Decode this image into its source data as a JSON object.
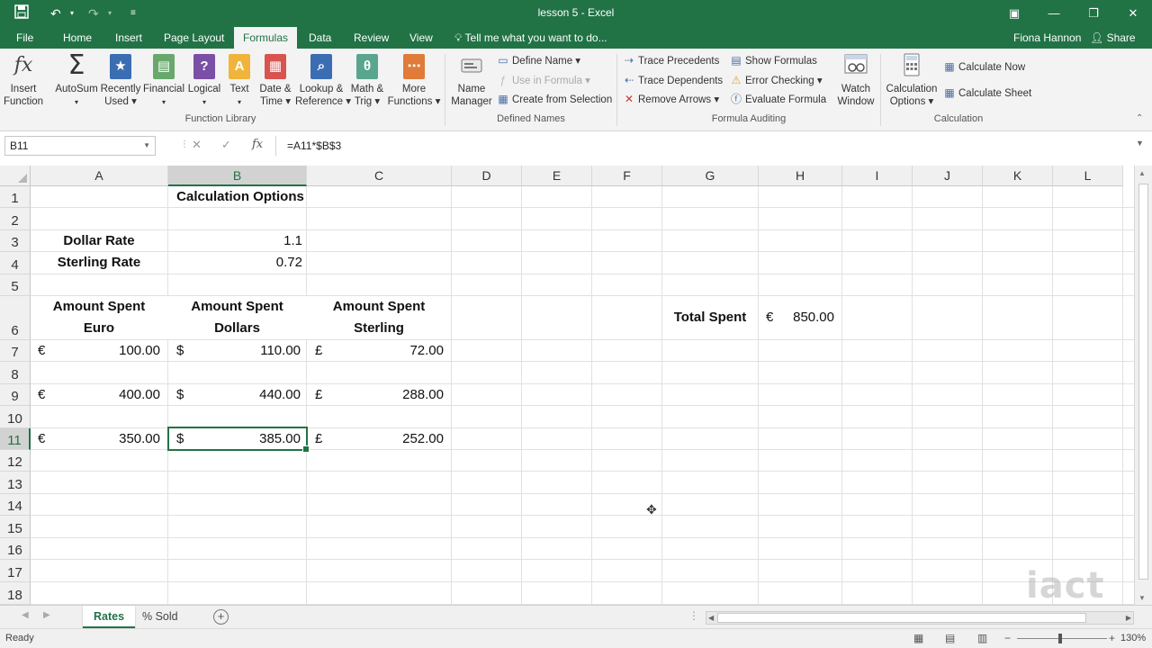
{
  "window": {
    "title": "lesson 5 - Excel"
  },
  "quick_access": {
    "save_icon": "save-icon",
    "undo_icon": "undo-icon",
    "redo_icon": "redo-icon",
    "customize_icon": "customize-icon"
  },
  "window_controls": {
    "ribbon_display": "ribbon-display-icon",
    "minimize": "minimize-icon",
    "restore": "restore-icon",
    "close": "close-icon"
  },
  "tabs": [
    "File",
    "Home",
    "Insert",
    "Page Layout",
    "Formulas",
    "Data",
    "Review",
    "View"
  ],
  "active_tab": "Formulas",
  "tell_me": "Tell me what you want to do...",
  "user": "Fiona Hannon",
  "share": "Share",
  "ribbon": {
    "function_library": {
      "label": "Function Library",
      "buttons": [
        {
          "line1": "Insert",
          "line2": "Function",
          "icon": "fx-icon"
        },
        {
          "line1": "AutoSum",
          "line2": "▾",
          "icon": "sigma-icon"
        },
        {
          "line1": "Recently",
          "line2": "Used ▾",
          "icon": "star-book-icon"
        },
        {
          "line1": "Financial",
          "line2": "▾",
          "icon": "financial-book-icon"
        },
        {
          "line1": "Logical",
          "line2": "▾",
          "icon": "logical-book-icon"
        },
        {
          "line1": "Text",
          "line2": "▾",
          "icon": "text-book-icon"
        },
        {
          "line1": "Date &",
          "line2": "Time ▾",
          "icon": "date-book-icon"
        },
        {
          "line1": "Lookup &",
          "line2": "Reference ▾",
          "icon": "lookup-book-icon"
        },
        {
          "line1": "Math &",
          "line2": "Trig ▾",
          "icon": "math-book-icon"
        },
        {
          "line1": "More",
          "line2": "Functions ▾",
          "icon": "more-book-icon"
        }
      ]
    },
    "defined_names": {
      "label": "Defined Names",
      "name_manager": {
        "line1": "Name",
        "line2": "Manager"
      },
      "items": [
        "Define Name ▾",
        "Use in Formula ▾",
        "Create from Selection"
      ]
    },
    "formula_auditing": {
      "label": "Formula Auditing",
      "items": [
        "Trace Precedents",
        "Trace Dependents",
        "Remove Arrows ▾",
        "Show Formulas",
        "Error Checking ▾",
        "Evaluate Formula"
      ],
      "watch_window": {
        "line1": "Watch",
        "line2": "Window"
      }
    },
    "calculation": {
      "label": "Calculation",
      "options": {
        "line1": "Calculation",
        "line2": "Options ▾"
      },
      "items": [
        "Calculate Now",
        "Calculate Sheet"
      ]
    }
  },
  "name_box": "B11",
  "formula": "=A11*$B$3",
  "formula_buttons": {
    "cancel": "✕",
    "enter": "✓",
    "fx": "fx"
  },
  "columns": [
    "A",
    "B",
    "C",
    "D",
    "E",
    "F",
    "G",
    "H",
    "I",
    "J",
    "K",
    "L"
  ],
  "rows": [
    "1",
    "2",
    "3",
    "4",
    "5",
    "6",
    "7",
    "8",
    "9",
    "10",
    "11",
    "12",
    "13",
    "14",
    "15",
    "16",
    "17",
    "18"
  ],
  "selected_cell": "B11",
  "cells": {
    "title": "Calculation Options",
    "dollar_rate_label": "Dollar Rate",
    "dollar_rate": "1.1",
    "sterling_rate_label": "Sterling Rate",
    "sterling_rate": "0.72",
    "hdr_euro_1": "Amount Spent",
    "hdr_euro_2": "Euro",
    "hdr_dollars_1": "Amount Spent",
    "hdr_dollars_2": "Dollars",
    "hdr_sterling_1": "Amount Spent",
    "hdr_sterling_2": "Sterling",
    "total_label": "Total Spent",
    "total_symbol": "€",
    "total_value": "850.00",
    "euro_symbol": "€",
    "dollar_symbol": "$",
    "pound_symbol": "£",
    "r7": {
      "euro": "100.00",
      "dollars": "110.00",
      "sterling": "72.00"
    },
    "r9": {
      "euro": "400.00",
      "dollars": "440.00",
      "sterling": "288.00"
    },
    "r11": {
      "euro": "350.00",
      "dollars": "385.00",
      "sterling": "252.00"
    }
  },
  "sheets": [
    "Rates",
    "% Sold"
  ],
  "active_sheet": "Rates",
  "status": {
    "ready": "Ready",
    "zoom": "130%"
  },
  "watermark": "iact",
  "colors": {
    "excel_green": "#217346",
    "ribbon_bg": "#f3f3f3"
  }
}
